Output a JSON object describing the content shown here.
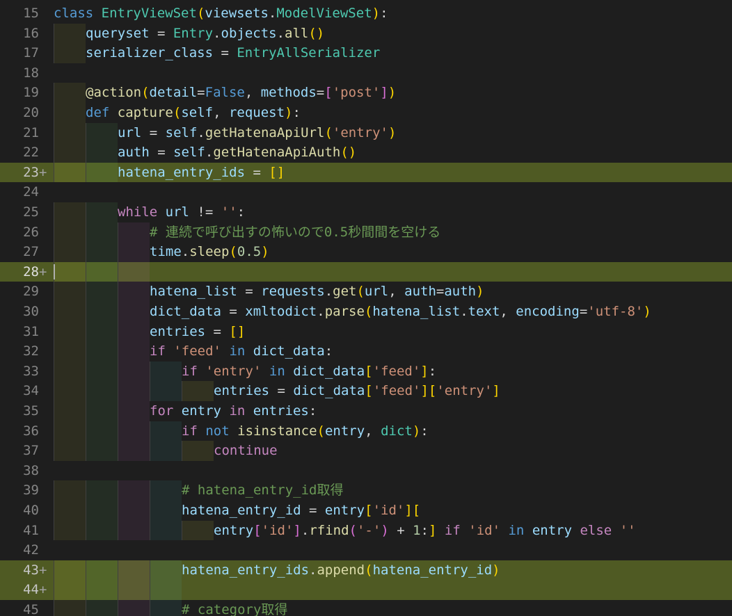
{
  "editor": {
    "lines": [
      {
        "num": "15",
        "mark": "",
        "added": false,
        "indent": 0,
        "tokens": [
          [
            "kw",
            "class"
          ],
          [
            "op",
            " "
          ],
          [
            "cls",
            "EntryViewSet"
          ],
          [
            "b1",
            "("
          ],
          [
            "var",
            "viewsets"
          ],
          [
            "op",
            "."
          ],
          [
            "cls",
            "ModelViewSet"
          ],
          [
            "b1",
            ")"
          ],
          [
            "op",
            ":"
          ]
        ]
      },
      {
        "num": "16",
        "mark": "",
        "added": false,
        "indent": 1,
        "tokens": [
          [
            "var",
            "queryset"
          ],
          [
            "op",
            " = "
          ],
          [
            "cls",
            "Entry"
          ],
          [
            "op",
            "."
          ],
          [
            "var",
            "objects"
          ],
          [
            "op",
            "."
          ],
          [
            "fn",
            "all"
          ],
          [
            "b1",
            "()"
          ]
        ]
      },
      {
        "num": "17",
        "mark": "",
        "added": false,
        "indent": 1,
        "tokens": [
          [
            "var",
            "serializer_class"
          ],
          [
            "op",
            " = "
          ],
          [
            "cls",
            "EntryAllSerializer"
          ]
        ]
      },
      {
        "num": "18",
        "mark": "",
        "added": false,
        "indent": 0,
        "tokens": []
      },
      {
        "num": "19",
        "mark": "",
        "added": false,
        "indent": 1,
        "tokens": [
          [
            "fn",
            "@action"
          ],
          [
            "b1",
            "("
          ],
          [
            "var",
            "detail"
          ],
          [
            "op",
            "="
          ],
          [
            "kw",
            "False"
          ],
          [
            "op",
            ", "
          ],
          [
            "var",
            "methods"
          ],
          [
            "op",
            "="
          ],
          [
            "b2",
            "["
          ],
          [
            "str",
            "'post'"
          ],
          [
            "b2",
            "]"
          ],
          [
            "b1",
            ")"
          ]
        ]
      },
      {
        "num": "20",
        "mark": "",
        "added": false,
        "indent": 1,
        "tokens": [
          [
            "kw",
            "def"
          ],
          [
            "op",
            " "
          ],
          [
            "fn",
            "capture"
          ],
          [
            "b1",
            "("
          ],
          [
            "var",
            "self"
          ],
          [
            "op",
            ", "
          ],
          [
            "var",
            "request"
          ],
          [
            "b1",
            ")"
          ],
          [
            "op",
            ":"
          ]
        ]
      },
      {
        "num": "21",
        "mark": "",
        "added": false,
        "indent": 2,
        "tokens": [
          [
            "var",
            "url"
          ],
          [
            "op",
            " = "
          ],
          [
            "var",
            "self"
          ],
          [
            "op",
            "."
          ],
          [
            "fn",
            "getHatenaApiUrl"
          ],
          [
            "b1",
            "("
          ],
          [
            "str",
            "'entry'"
          ],
          [
            "b1",
            ")"
          ]
        ]
      },
      {
        "num": "22",
        "mark": "",
        "added": false,
        "indent": 2,
        "tokens": [
          [
            "var",
            "auth"
          ],
          [
            "op",
            " = "
          ],
          [
            "var",
            "self"
          ],
          [
            "op",
            "."
          ],
          [
            "fn",
            "getHatenaApiAuth"
          ],
          [
            "b1",
            "()"
          ]
        ]
      },
      {
        "num": "23",
        "mark": "+",
        "added": true,
        "indent": 2,
        "tokens": [
          [
            "var",
            "hatena_entry_ids"
          ],
          [
            "op",
            " = "
          ],
          [
            "b1",
            "[]"
          ]
        ]
      },
      {
        "num": "24",
        "mark": "",
        "added": false,
        "indent": 0,
        "tokens": []
      },
      {
        "num": "25",
        "mark": "",
        "added": false,
        "indent": 2,
        "tokens": [
          [
            "ctl",
            "while"
          ],
          [
            "op",
            " "
          ],
          [
            "var",
            "url"
          ],
          [
            "op",
            " != "
          ],
          [
            "str",
            "''"
          ],
          [
            "op",
            ":"
          ]
        ]
      },
      {
        "num": "26",
        "mark": "",
        "added": false,
        "indent": 3,
        "tokens": [
          [
            "cmt",
            "# 連続で呼び出すの怖いので0.5秒間間を空ける"
          ]
        ]
      },
      {
        "num": "27",
        "mark": "",
        "added": false,
        "indent": 3,
        "tokens": [
          [
            "var",
            "time"
          ],
          [
            "op",
            "."
          ],
          [
            "fn",
            "sleep"
          ],
          [
            "b1",
            "("
          ],
          [
            "num",
            "0.5"
          ],
          [
            "b1",
            ")"
          ]
        ]
      },
      {
        "num": "28",
        "mark": "+",
        "added": true,
        "current": true,
        "indent": 0,
        "tokens": []
      },
      {
        "num": "29",
        "mark": "",
        "added": false,
        "indent": 3,
        "tokens": [
          [
            "var",
            "hatena_list"
          ],
          [
            "op",
            " = "
          ],
          [
            "var",
            "requests"
          ],
          [
            "op",
            "."
          ],
          [
            "fn",
            "get"
          ],
          [
            "b1",
            "("
          ],
          [
            "var",
            "url"
          ],
          [
            "op",
            ", "
          ],
          [
            "var",
            "auth"
          ],
          [
            "op",
            "="
          ],
          [
            "var",
            "auth"
          ],
          [
            "b1",
            ")"
          ]
        ]
      },
      {
        "num": "30",
        "mark": "",
        "added": false,
        "indent": 3,
        "tokens": [
          [
            "var",
            "dict_data"
          ],
          [
            "op",
            " = "
          ],
          [
            "var",
            "xmltodict"
          ],
          [
            "op",
            "."
          ],
          [
            "fn",
            "parse"
          ],
          [
            "b1",
            "("
          ],
          [
            "var",
            "hatena_list"
          ],
          [
            "op",
            "."
          ],
          [
            "var",
            "text"
          ],
          [
            "op",
            ", "
          ],
          [
            "var",
            "encoding"
          ],
          [
            "op",
            "="
          ],
          [
            "str",
            "'utf-8'"
          ],
          [
            "b1",
            ")"
          ]
        ]
      },
      {
        "num": "31",
        "mark": "",
        "added": false,
        "indent": 3,
        "tokens": [
          [
            "var",
            "entries"
          ],
          [
            "op",
            " = "
          ],
          [
            "b1",
            "[]"
          ]
        ]
      },
      {
        "num": "32",
        "mark": "",
        "added": false,
        "indent": 3,
        "tokens": [
          [
            "ctl",
            "if"
          ],
          [
            "op",
            " "
          ],
          [
            "str",
            "'feed'"
          ],
          [
            "op",
            " "
          ],
          [
            "kw",
            "in"
          ],
          [
            "op",
            " "
          ],
          [
            "var",
            "dict_data"
          ],
          [
            "op",
            ":"
          ]
        ]
      },
      {
        "num": "33",
        "mark": "",
        "added": false,
        "indent": 4,
        "tokens": [
          [
            "ctl",
            "if"
          ],
          [
            "op",
            " "
          ],
          [
            "str",
            "'entry'"
          ],
          [
            "op",
            " "
          ],
          [
            "kw",
            "in"
          ],
          [
            "op",
            " "
          ],
          [
            "var",
            "dict_data"
          ],
          [
            "b1",
            "["
          ],
          [
            "str",
            "'feed'"
          ],
          [
            "b1",
            "]"
          ],
          [
            "op",
            ":"
          ]
        ]
      },
      {
        "num": "34",
        "mark": "",
        "added": false,
        "indent": 5,
        "tokens": [
          [
            "var",
            "entries"
          ],
          [
            "op",
            " = "
          ],
          [
            "var",
            "dict_data"
          ],
          [
            "b1",
            "["
          ],
          [
            "str",
            "'feed'"
          ],
          [
            "b1",
            "]["
          ],
          [
            "str",
            "'entry'"
          ],
          [
            "b1",
            "]"
          ]
        ]
      },
      {
        "num": "35",
        "mark": "",
        "added": false,
        "indent": 3,
        "tokens": [
          [
            "ctl",
            "for"
          ],
          [
            "op",
            " "
          ],
          [
            "var",
            "entry"
          ],
          [
            "op",
            " "
          ],
          [
            "ctl",
            "in"
          ],
          [
            "op",
            " "
          ],
          [
            "var",
            "entries"
          ],
          [
            "op",
            ":"
          ]
        ]
      },
      {
        "num": "36",
        "mark": "",
        "added": false,
        "indent": 4,
        "tokens": [
          [
            "ctl",
            "if"
          ],
          [
            "op",
            " "
          ],
          [
            "kw",
            "not"
          ],
          [
            "op",
            " "
          ],
          [
            "fn",
            "isinstance"
          ],
          [
            "b1",
            "("
          ],
          [
            "var",
            "entry"
          ],
          [
            "op",
            ", "
          ],
          [
            "cls",
            "dict"
          ],
          [
            "b1",
            ")"
          ],
          [
            "op",
            ":"
          ]
        ]
      },
      {
        "num": "37",
        "mark": "",
        "added": false,
        "indent": 5,
        "tokens": [
          [
            "ctl",
            "continue"
          ]
        ]
      },
      {
        "num": "38",
        "mark": "",
        "added": false,
        "indent": 0,
        "tokens": []
      },
      {
        "num": "39",
        "mark": "",
        "added": false,
        "indent": 4,
        "tokens": [
          [
            "cmt",
            "# hatena_entry_id取得"
          ]
        ]
      },
      {
        "num": "40",
        "mark": "",
        "added": false,
        "indent": 4,
        "tokens": [
          [
            "var",
            "hatena_entry_id"
          ],
          [
            "op",
            " = "
          ],
          [
            "var",
            "entry"
          ],
          [
            "b1",
            "["
          ],
          [
            "str",
            "'id'"
          ],
          [
            "b1",
            "]["
          ]
        ]
      },
      {
        "num": "41",
        "mark": "",
        "added": false,
        "indent": 5,
        "tokens": [
          [
            "var",
            "entry"
          ],
          [
            "b2",
            "["
          ],
          [
            "str",
            "'id'"
          ],
          [
            "b2",
            "]"
          ],
          [
            "op",
            "."
          ],
          [
            "fn",
            "rfind"
          ],
          [
            "b2",
            "("
          ],
          [
            "str",
            "'-'"
          ],
          [
            "b2",
            ")"
          ],
          [
            "op",
            " + "
          ],
          [
            "num",
            "1"
          ],
          [
            "op",
            ":"
          ],
          [
            "b1",
            "]"
          ],
          [
            "op",
            " "
          ],
          [
            "ctl",
            "if"
          ],
          [
            "op",
            " "
          ],
          [
            "str",
            "'id'"
          ],
          [
            "op",
            " "
          ],
          [
            "kw",
            "in"
          ],
          [
            "op",
            " "
          ],
          [
            "var",
            "entry"
          ],
          [
            "op",
            " "
          ],
          [
            "ctl",
            "else"
          ],
          [
            "op",
            " "
          ],
          [
            "str",
            "''"
          ]
        ]
      },
      {
        "num": "42",
        "mark": "",
        "added": false,
        "indent": 0,
        "tokens": []
      },
      {
        "num": "43",
        "mark": "+",
        "added": true,
        "indent": 4,
        "tokens": [
          [
            "var",
            "hatena_entry_ids"
          ],
          [
            "op",
            "."
          ],
          [
            "fn",
            "append"
          ],
          [
            "b1",
            "("
          ],
          [
            "var",
            "hatena_entry_id"
          ],
          [
            "b1",
            ")"
          ]
        ]
      },
      {
        "num": "44",
        "mark": "+",
        "added": true,
        "indent": 0,
        "tokens": []
      },
      {
        "num": "45",
        "mark": "",
        "added": false,
        "indent": 4,
        "tokens": [
          [
            "cmt",
            "# category取得"
          ]
        ]
      }
    ],
    "guides": {
      "15": [],
      "16": [
        1
      ],
      "17": [
        1
      ],
      "18": [],
      "19": [
        1
      ],
      "20": [
        1
      ],
      "21": [
        1,
        2
      ],
      "22": [
        1,
        2
      ],
      "23": [
        1,
        2
      ],
      "24": [],
      "25": [
        1,
        2
      ],
      "26": [
        1,
        2,
        3
      ],
      "27": [
        1,
        2,
        3
      ],
      "28": [
        1,
        2,
        3
      ],
      "29": [
        1,
        2,
        3
      ],
      "30": [
        1,
        2,
        3
      ],
      "31": [
        1,
        2,
        3
      ],
      "32": [
        1,
        2,
        3
      ],
      "33": [
        1,
        2,
        3,
        4
      ],
      "34": [
        1,
        2,
        3,
        4,
        5
      ],
      "35": [
        1,
        2,
        3
      ],
      "36": [
        1,
        2,
        3,
        4
      ],
      "37": [
        1,
        2,
        3,
        4,
        5
      ],
      "38": [],
      "39": [
        1,
        2,
        3,
        4
      ],
      "40": [
        1,
        2,
        3,
        4
      ],
      "41": [
        1,
        2,
        3,
        4,
        5
      ],
      "42": [],
      "43": [
        1,
        2,
        3,
        4
      ],
      "44": [
        1,
        2,
        3,
        4
      ],
      "45": [
        1,
        2,
        3,
        4
      ]
    }
  }
}
